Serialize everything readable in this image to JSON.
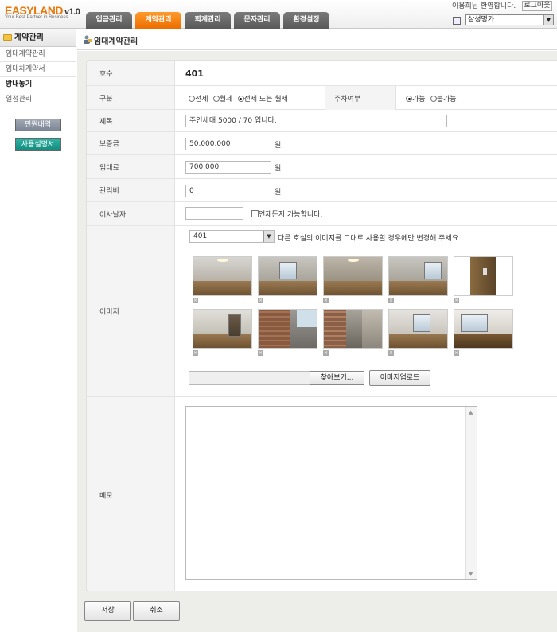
{
  "header": {
    "logo": "EASYLAND",
    "version": "v1.0",
    "tagline": "Your Best Partner in Business",
    "tabs": [
      {
        "label": "입금관리",
        "active": false
      },
      {
        "label": "계약관리",
        "active": true
      },
      {
        "label": "회계관리",
        "active": false
      },
      {
        "label": "문자관리",
        "active": false
      },
      {
        "label": "환경설정",
        "active": false
      }
    ],
    "welcome": "이용희님 환영합니다.",
    "logout_label": "로그아웃",
    "building_select": "삼성명가"
  },
  "sidebar": {
    "title": "계약관리",
    "items": [
      {
        "label": "임대계약관리"
      },
      {
        "label": "임대차계약서"
      },
      {
        "label": "방내놓기"
      },
      {
        "label": "일정관리"
      }
    ],
    "complaint_button": "민원내역",
    "manual_button": "사용설명서"
  },
  "page": {
    "title": "임대계약관리"
  },
  "form": {
    "room_label": "호수",
    "room_value": "401",
    "type_label": "구분",
    "type_options": [
      "전세",
      "월세",
      "전세 또는 월세"
    ],
    "type_selected": "전세 또는 월세",
    "parking_label": "주차여부",
    "parking_options": [
      "가능",
      "불가능"
    ],
    "parking_selected": "가능",
    "subject_label": "제목",
    "subject_value": "주인세대 5000 / 70 입니다.",
    "deposit_label": "보증금",
    "deposit_value": "50,000,000",
    "rent_label": "임대료",
    "rent_value": "700,000",
    "fee_label": "관리비",
    "fee_value": "0",
    "unit_won": "원",
    "move_label": "이사날자",
    "move_value": "",
    "anytime_label": "언제든지 가능합니다.",
    "image_label": "이미지",
    "image_room_select": "401",
    "image_hint": "다른 호실의 이미지를 그대로 사용할 경우에만 변경해 주세요",
    "browse_label": "찾아보기...",
    "upload_label": "이미지업로드",
    "memo_label": "메모",
    "memo_value": ""
  },
  "actions": {
    "save_label": "저장",
    "cancel_label": "취소"
  },
  "colors": {
    "active_tab": "#ec6d00",
    "tab": "#666666",
    "manual_button": "#14897c",
    "complaint_button": "#7c8594"
  }
}
